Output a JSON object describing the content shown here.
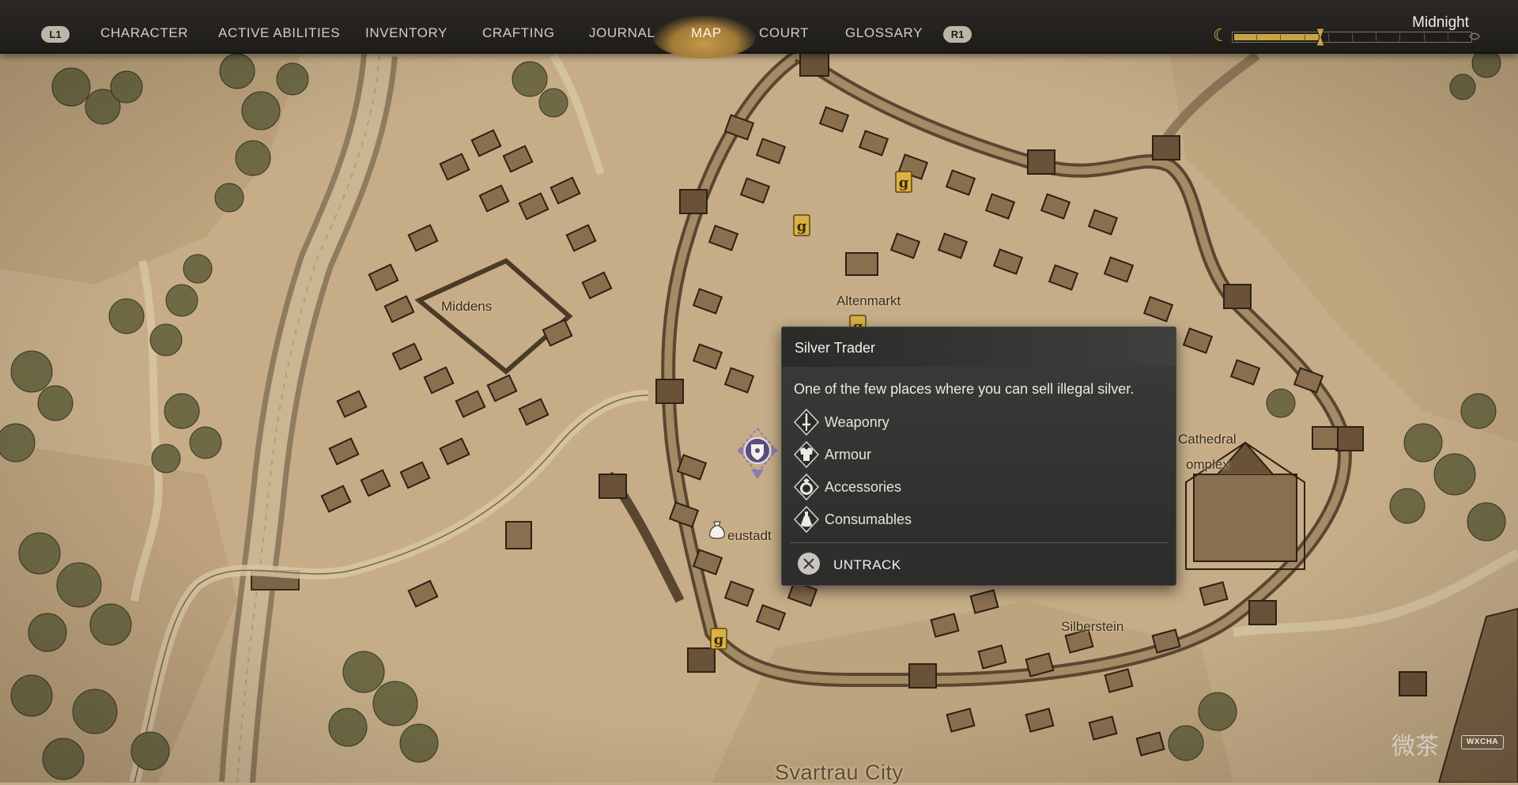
{
  "nav": {
    "left_shoulder": "L1",
    "right_shoulder": "R1",
    "tabs": [
      {
        "label": "CHARACTER",
        "active": false
      },
      {
        "label": "ACTIVE ABILITIES",
        "active": false
      },
      {
        "label": "INVENTORY",
        "active": false
      },
      {
        "label": "CRAFTING",
        "active": false
      },
      {
        "label": "JOURNAL",
        "active": false
      },
      {
        "label": "MAP",
        "active": true
      },
      {
        "label": "COURT",
        "active": false
      },
      {
        "label": "GLOSSARY",
        "active": false
      }
    ]
  },
  "time": {
    "label": "Midnight",
    "progress": 0.37,
    "icon": "moon-icon",
    "accent_color": "#c8a441"
  },
  "map": {
    "labels": {
      "middens": "Middens",
      "altenmarkt": "Altenmarkt",
      "cathedral_line1": "Cathedral",
      "cathedral_line2": "omplex",
      "neustadt": "eustadt",
      "silberstein": "Silberstein",
      "city": "Svartrau City"
    },
    "marker_icons": [
      "quest-marker-icon",
      "tracked-location-icon",
      "money-bag-icon"
    ]
  },
  "tooltip": {
    "title": "Silver Trader",
    "description": "One of the few places where you can sell illegal silver.",
    "items": [
      {
        "label": "Weaponry",
        "icon": "sword-icon"
      },
      {
        "label": "Armour",
        "icon": "armour-icon"
      },
      {
        "label": "Accessories",
        "icon": "ring-icon"
      },
      {
        "label": "Consumables",
        "icon": "potion-icon"
      }
    ],
    "action": {
      "label": "UNTRACK",
      "icon": "cross-button-icon"
    }
  },
  "watermark": {
    "glyphs": "微茶",
    "text": "WXCHA"
  }
}
